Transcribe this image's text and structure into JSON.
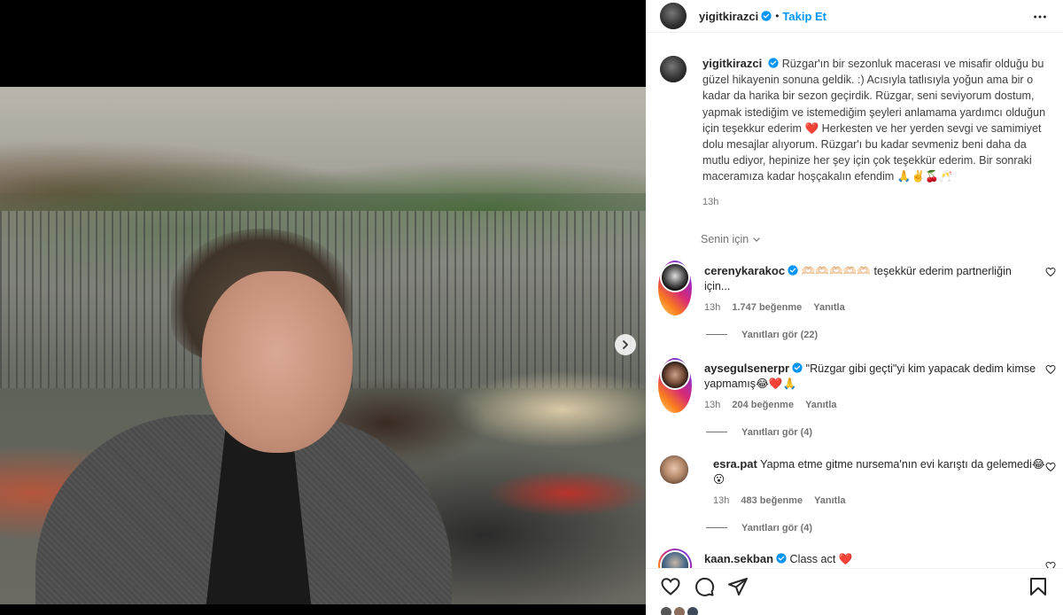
{
  "post": {
    "username": "yigitkirazci",
    "follow_label": "Takip Et",
    "dot": "•",
    "caption": "Rüzgar'ın bir sezonluk macerası ve misafir olduğu bu güzel hikayenin sonuna geldik. :) Acısıyla tatlısıyla yoğun ama bir o kadar da harika bir sezon geçirdik. Rüzgar, seni seviyorum dostum, yapmak istediğim ve istemediğim şeyleri anlamama yardımcı olduğun için teşekkur ederim",
    "caption_heart": "❤️",
    "caption_rest": " Herkesten ve her yerden sevgi ve samimiyet dolu mesajlar alıyorum. Rüzgar'ı bu kadar sevmeniz beni daha da mutlu ediyor, hepinize her şey için çok teşekkür ederim. Bir sonraki maceramıza kadar hoşçakalın efendim ",
    "caption_emojis": "🙏✌️🍒🥂",
    "time": "13h"
  },
  "filter": {
    "label": "Senin için"
  },
  "comments": [
    {
      "username": "cerenykarakoc",
      "text": "🫶🏻🫶🏻🫶🏻🫶🏻🫶🏻 teşekkür ederim partnerliğin için...",
      "time": "13h",
      "likes": "1.747 beğenme",
      "reply": "Yanıtla",
      "view_replies": "Yanıtları gör (22)"
    },
    {
      "username": "aysegulsenerpr",
      "text": "\"Rüzgar gibi geçti\"yi kim yapacak dedim kimse yapmamış😂❤️🙏",
      "time": "13h",
      "likes": "204 beğenme",
      "reply": "Yanıtla",
      "view_replies": "Yanıtları gör (4)"
    },
    {
      "username": "esra.pat",
      "text": "Yapma etme gitme nursema'nın evi karıştı da gelemedi😂😮",
      "time": "13h",
      "likes": "483 beğenme",
      "reply": "Yanıtla",
      "view_replies": "Yanıtları gör (4)"
    },
    {
      "username": "kaan.sekban",
      "text": "Class act ❤️"
    }
  ],
  "colors": {
    "accent": "#0095f6",
    "verified": "#0095f6",
    "heart": "#ed2e3f",
    "muted": "#737373"
  },
  "icons": {
    "more": "more-horizontal-icon",
    "verified": "verified-badge-icon",
    "like": "heart-outline-icon",
    "comment": "comment-bubble-icon",
    "share": "paper-plane-icon",
    "save": "bookmark-icon",
    "next": "chevron-right-icon"
  }
}
